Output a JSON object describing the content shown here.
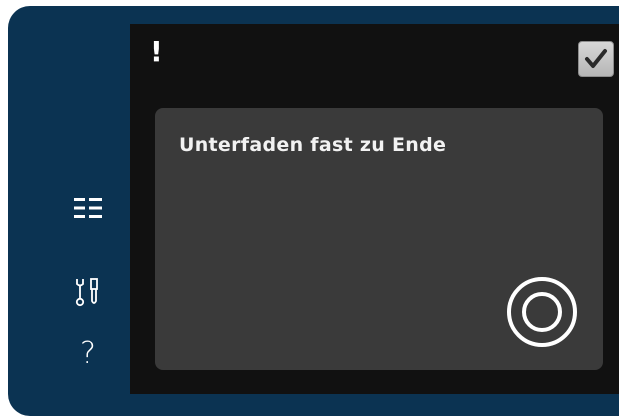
{
  "sidebar": {
    "items": [
      {
        "icon": "list-icon"
      },
      {
        "icon": "tools-icon"
      },
      {
        "icon": "help-icon",
        "label": "?"
      }
    ]
  },
  "header": {
    "alert_symbol": "!",
    "confirm_icon": "checkmark-icon"
  },
  "message": {
    "text": "Unterfaden fast zu Ende",
    "action_icon": "target-circle-icon"
  },
  "colors": {
    "frame": "#0b3352",
    "screen": "#111111",
    "panel": "#3a3a3a",
    "text": "#f2f2f2"
  }
}
